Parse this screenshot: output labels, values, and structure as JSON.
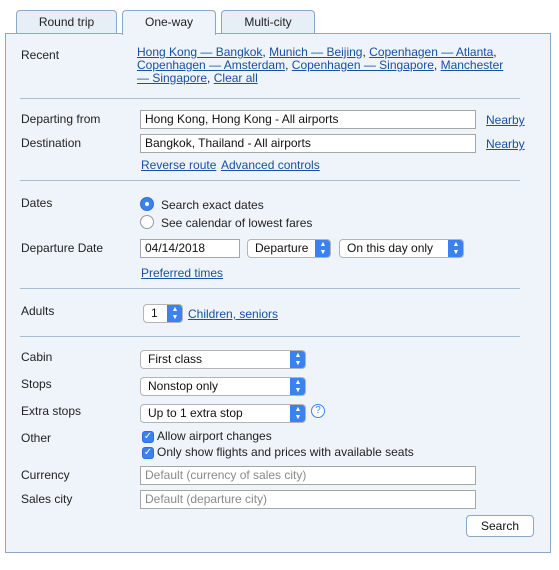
{
  "tabs": [
    {
      "label": "Round trip",
      "active": false
    },
    {
      "label": "One-way",
      "active": true
    },
    {
      "label": "Multi-city",
      "active": false
    }
  ],
  "recent": {
    "label": "Recent",
    "routes": [
      "Hong Kong — Bangkok",
      "Munich — Beijing",
      "Copenhagen — Atlanta",
      "Copenhagen — Amsterdam",
      "Copenhagen — Singapore",
      "Manchester — Singapore"
    ],
    "separator": ",",
    "clear_all": "Clear all"
  },
  "route": {
    "from_label": "Departing from",
    "from_value": "Hong Kong, Hong Kong - All airports",
    "to_label": "Destination",
    "to_value": "Bangkok, Thailand - All airports",
    "nearby": "Nearby",
    "reverse_route": "Reverse route",
    "advanced_controls": "Advanced controls"
  },
  "dates": {
    "label": "Dates",
    "option_exact": "Search exact dates",
    "option_calendar": "See calendar of lowest fares",
    "selected": "exact",
    "departure_label": "Departure Date",
    "departure_value": "04/14/2018",
    "type_select": "Departure",
    "flex_select": "On this day only",
    "preferred_times": "Preferred times"
  },
  "passengers": {
    "label": "Adults",
    "count": "1",
    "children_link": "Children, seniors"
  },
  "options": {
    "cabin_label": "Cabin",
    "cabin_value": "First class",
    "stops_label": "Stops",
    "stops_value": "Nonstop only",
    "extra_stops_label": "Extra stops",
    "extra_stops_value": "Up to 1 extra stop",
    "other_label": "Other",
    "allow_airport_changes": "Allow airport changes",
    "only_available_seats": "Only show flights and prices with available seats",
    "currency_label": "Currency",
    "currency_placeholder": "Default (currency of sales city)",
    "sales_city_label": "Sales city",
    "sales_city_placeholder": "Default (departure city)"
  },
  "search_button": "Search",
  "colors": {
    "panel_bg": "#eef4fa",
    "border": "#8aa9c8",
    "link": "#1a4fa3",
    "accent": "#3b82f0"
  }
}
